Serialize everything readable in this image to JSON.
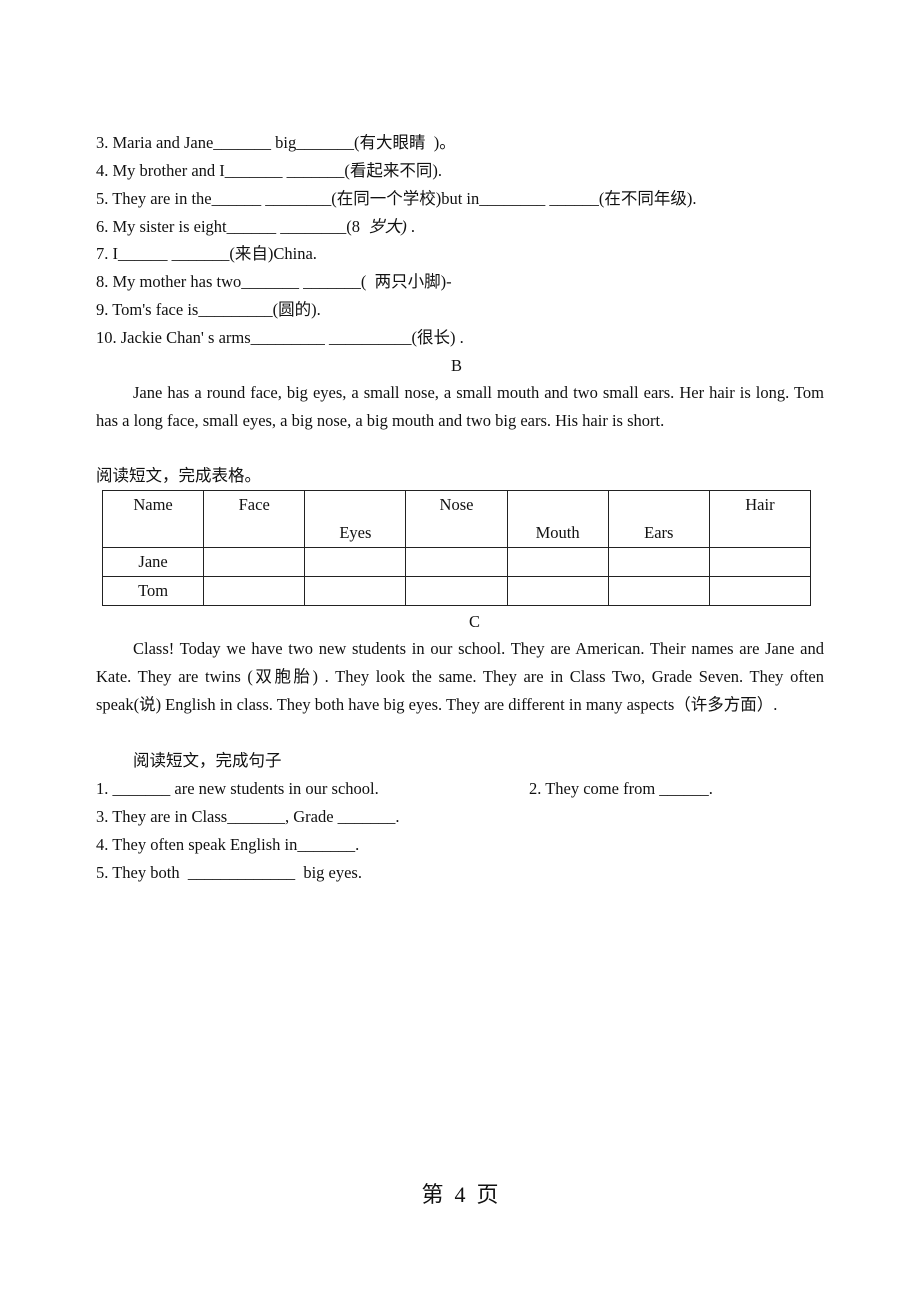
{
  "section_a": {
    "items": [
      "3. Maria and Jane_______ big_______(有大眼睛  )。",
      "4. My brother and I_______ _______(看起来不同).",
      "5. They are in the______ ________(在同一个学校)but in________ ______(在不同年级).",
      "6. My sister is eight______ ________(8  ",
      "7. I______ _______(来自)China.",
      "8. My mother has two_______ _______(  两只小脚)-",
      "9. Tom's face is_________(圆的).",
      "10. Jackie Chan' s arms_________ __________(很长) ."
    ],
    "item6_italic": "岁大)",
    "item6_tail": " ."
  },
  "section_b": {
    "heading": "B",
    "passage": "Jane has a round face, big eyes, a small nose, a small mouth and two small ears. Her hair is long. Tom has a long face, small eyes, a big nose, a big mouth and two big ears.    His hair is short.",
    "instruction": "阅读短文，完成表格。",
    "table": {
      "headers": [
        "Name",
        "Face",
        "Eyes",
        "Nose",
        "Mouth",
        "Ears",
        "Hair"
      ],
      "rows": [
        [
          "Jane",
          "",
          "",
          "",
          "",
          "",
          ""
        ],
        [
          "Tom",
          "",
          "",
          "",
          "",
          "",
          ""
        ]
      ]
    }
  },
  "section_c": {
    "heading": "C",
    "passage": "Class! Today we have two new students in our school. They are American. Their names are Jane and Kate. They are twins (双胞胎) . They look the same. They are in Class Two, Grade Seven. They often speak(说) English in class.    They both have big eyes.    They are different in many aspects（许多方面）.",
    "instruction": "阅读短文，完成句子",
    "questions": [
      "1. _______ are new students in our school.",
      "2. They come from ______.",
      "3. They are in Class_______, Grade _______.",
      "4. They often speak English in_______.",
      "5. They both  _____________  big eyes."
    ]
  },
  "footer": {
    "page_label": "第  4  页"
  }
}
